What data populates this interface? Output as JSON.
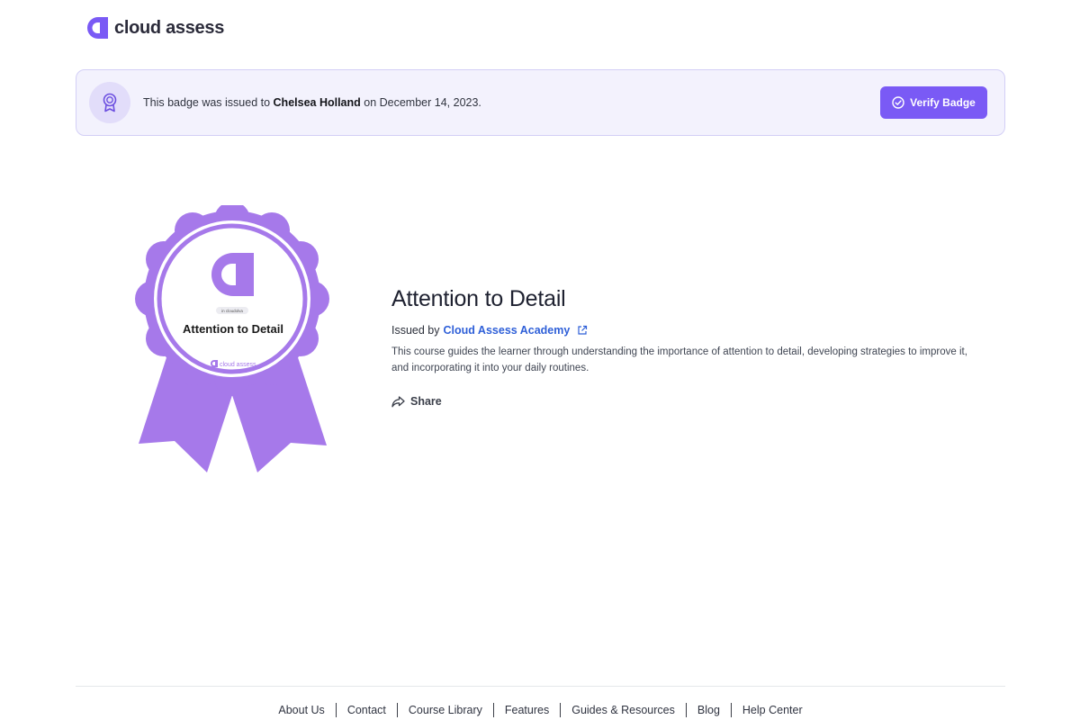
{
  "brand": {
    "name": "cloud assess",
    "accent": "#7a5af5"
  },
  "banner": {
    "text_prefix": "This badge was issued to ",
    "recipient": "Chelsea Holland",
    "text_suffix": " on December 14, 2023.",
    "verify_label": "Verify Badge"
  },
  "badge": {
    "top_label": "in cloudolva",
    "title": "Attention to Detail",
    "brand_mark": "cloud assess"
  },
  "course": {
    "title": "Attention to Detail",
    "issued_by_label": "Issued by",
    "issuer": "Cloud Assess Academy",
    "description": "This course guides the learner through understanding the importance of attention to detail, developing strategies to improve it, and incorporating it into your daily routines.",
    "share_label": "Share"
  },
  "footer": {
    "links": [
      "About Us",
      "Contact",
      "Course Library",
      "Features",
      "Guides & Resources",
      "Blog",
      "Help Center"
    ]
  }
}
